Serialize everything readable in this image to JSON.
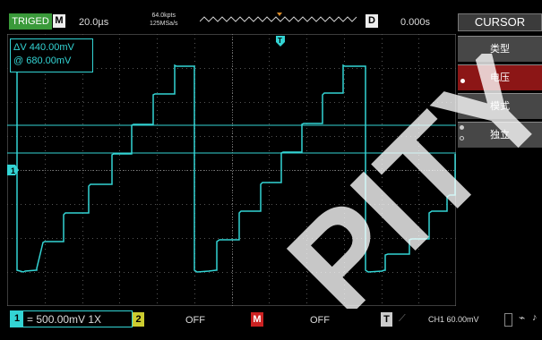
{
  "topbar": {
    "trig_status": "TRIGED",
    "mode": "M",
    "timebase": "20.0µs",
    "mem_depth": "64.0kpts",
    "sample_rate": "125MSa/s",
    "delay_badge": "D",
    "delay": "0.000s",
    "menu_title": "CURSOR"
  },
  "readout": {
    "delta": "ΔV 440.00mV",
    "at": "@  680.00mV"
  },
  "menu": {
    "items": [
      {
        "label": "类型"
      },
      {
        "label": "电压"
      },
      {
        "label": "模式"
      },
      {
        "label": "独立"
      }
    ]
  },
  "markers": {
    "ch1": "1",
    "trigger": "T"
  },
  "bottombar": {
    "ch1_num": "1",
    "ch1_setting": "= 500.00mV 1X",
    "ch2_num": "2",
    "ch2_setting": "OFF",
    "math_num": "M",
    "math_setting": "OFF",
    "trig_num": "T",
    "trig_slope": "⟋",
    "trig_setting": "CH1 60.00mV"
  },
  "icons": {
    "usb": "usb-icon",
    "battery": "battery-icon"
  },
  "colors": {
    "trace": "#33d4d4",
    "trig_badge": "#3a9a3a",
    "menu_active": "#8c1616"
  },
  "watermark": "PITY"
}
